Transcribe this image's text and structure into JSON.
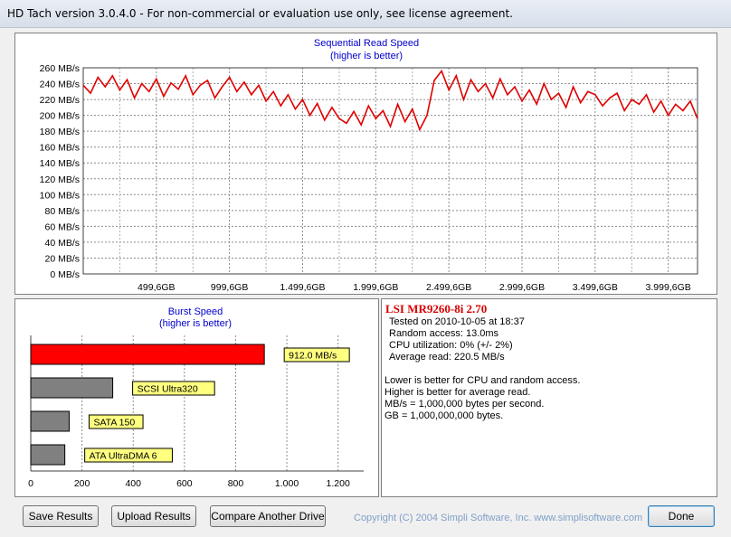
{
  "window": {
    "title": "HD Tach version 3.0.4.0  - For non-commercial or evaluation use only, see license agreement."
  },
  "sequential": {
    "title": "Sequential Read Speed",
    "subtitle": "(higher is better)",
    "line_color": "#e00000",
    "y_ticks": [
      "0 MB/s",
      "20 MB/s",
      "40 MB/s",
      "60 MB/s",
      "80 MB/s",
      "100 MB/s",
      "120 MB/s",
      "140 MB/s",
      "160 MB/s",
      "180 MB/s",
      "200 MB/s",
      "220 MB/s",
      "240 MB/s",
      "260 MB/s"
    ],
    "x_ticks": [
      "499,6GB",
      "999,6GB",
      "1.499,6GB",
      "1.999,6GB",
      "2.499,6GB",
      "2.999,6GB",
      "3.499,6GB",
      "3.999,6GB"
    ]
  },
  "burst": {
    "title": "Burst Speed",
    "subtitle": "(higher is better)",
    "x_ticks": [
      "0",
      "200",
      "400",
      "600",
      "800",
      "1.000",
      "1.200"
    ]
  },
  "info": {
    "drive_name": "LSI MR9260-8i 2.70",
    "tested_on": "Tested on 2010-10-05 at 18:37",
    "random_access": "Random access: 13.0ms",
    "cpu": "CPU utilization: 0% (+/- 2%)",
    "avg_read": "Average read: 220.5 MB/s",
    "notes": [
      "Lower is better for CPU and random access.",
      "Higher is better for average read.",
      "MB/s = 1,000,000 bytes per second.",
      "GB = 1,000,000,000 bytes."
    ]
  },
  "buttons": {
    "save": "Save Results",
    "upload": "Upload Results",
    "compare": "Compare Another Drive",
    "done": "Done"
  },
  "copyright": "Copyright (C) 2004 Simpli Software, Inc. www.simplisoftware.com",
  "chart_data": [
    {
      "type": "line",
      "title": "Sequential Read Speed",
      "subtitle": "(higher is better)",
      "xlabel": "",
      "ylabel": "",
      "ylim": [
        0,
        260
      ],
      "xlim": [
        0,
        4199.6
      ],
      "grid": true,
      "series": [
        {
          "x": [
            0,
            50,
            100,
            150,
            200,
            250,
            300,
            350,
            400,
            450,
            500,
            550,
            600,
            650,
            700,
            750,
            800,
            850,
            900,
            950,
            1000,
            1050,
            1100,
            1150,
            1200,
            1250,
            1300,
            1350,
            1400,
            1450,
            1500,
            1550,
            1600,
            1650,
            1700,
            1750,
            1800,
            1850,
            1900,
            1950,
            2000,
            2050,
            2100,
            2150,
            2200,
            2250,
            2300,
            2350,
            2400,
            2450,
            2500,
            2550,
            2600,
            2650,
            2700,
            2750,
            2800,
            2850,
            2900,
            2950,
            3000,
            3050,
            3100,
            3150,
            3200,
            3250,
            3300,
            3350,
            3400,
            3450,
            3500,
            3550,
            3600,
            3650,
            3700,
            3750,
            3800,
            3850,
            3900,
            3950,
            4000,
            4050,
            4100,
            4150,
            4199
          ],
          "values": [
            238,
            228,
            248,
            236,
            250,
            232,
            245,
            222,
            240,
            230,
            246,
            224,
            241,
            233,
            250,
            226,
            238,
            244,
            222,
            236,
            248,
            230,
            242,
            226,
            238,
            218,
            230,
            212,
            226,
            208,
            220,
            200,
            215,
            194,
            210,
            196,
            190,
            205,
            188,
            212,
            196,
            206,
            186,
            214,
            192,
            208,
            182,
            200,
            244,
            256,
            232,
            250,
            220,
            245,
            230,
            240,
            222,
            246,
            226,
            236,
            218,
            232,
            214,
            240,
            220,
            228,
            210,
            236,
            216,
            230,
            226,
            212,
            222,
            228,
            206,
            220,
            214,
            226,
            204,
            218,
            200,
            214,
            206,
            218,
            196
          ]
        }
      ]
    },
    {
      "type": "bar",
      "title": "Burst Speed",
      "subtitle": "(higher is better)",
      "categories": [
        "LSI MR9260-8i 2.70",
        "SCSI Ultra320",
        "SATA 150",
        "ATA UltraDMA 6"
      ],
      "values": [
        912.0,
        320,
        150,
        133
      ],
      "labels": [
        "912.0 MB/s",
        "SCSI Ultra320",
        "SATA 150",
        "ATA UltraDMA 6"
      ],
      "colors": [
        "#ff0000",
        "#808080",
        "#808080",
        "#808080"
      ],
      "xlim": [
        0,
        1300
      ]
    }
  ]
}
